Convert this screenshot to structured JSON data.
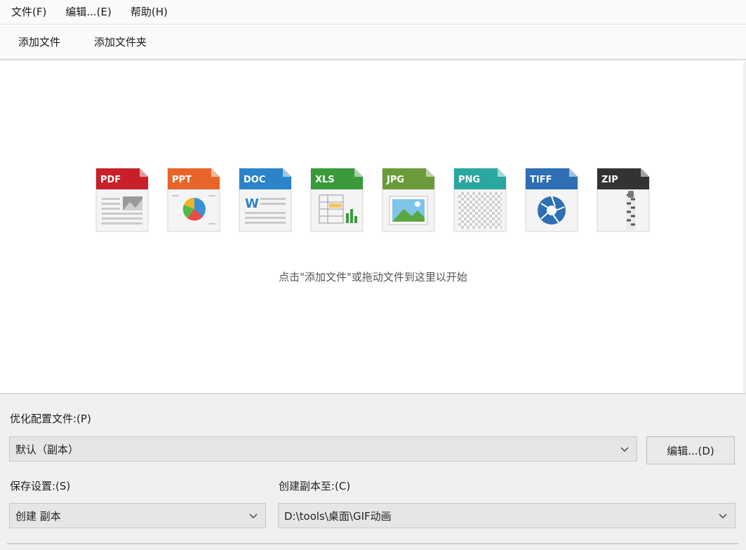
{
  "menubar": {
    "items": [
      {
        "label": "文件(F)"
      },
      {
        "label": "编辑...(E)"
      },
      {
        "label": "帮助(H)"
      }
    ]
  },
  "toolbar": {
    "add_file": "添加文件",
    "add_folder": "添加文件夹"
  },
  "droparea": {
    "file_types": [
      {
        "label": "PDF",
        "color": "#c8202a"
      },
      {
        "label": "PPT",
        "color": "#e8652a"
      },
      {
        "label": "DOC",
        "color": "#2d83c9"
      },
      {
        "label": "XLS",
        "color": "#3a9a3a"
      },
      {
        "label": "JPG",
        "color": "#6a9a3a"
      },
      {
        "label": "PNG",
        "color": "#2aa8a0"
      },
      {
        "label": "TIFF",
        "color": "#2e6fb5"
      },
      {
        "label": "ZIP",
        "color": "#333333"
      }
    ],
    "hint": "点击\"添加文件\"或拖动文件到这里以开始"
  },
  "settings": {
    "profile_label": "优化配置文件:(P)",
    "profile_value": "默认（副本）",
    "edit_button": "编辑...(D)",
    "save_label": "保存设置:(S)",
    "save_value": "创建 副本",
    "copy_to_label": "创建副本至:(C)",
    "copy_to_value": "D:\\tools\\桌面\\GIF动画"
  }
}
